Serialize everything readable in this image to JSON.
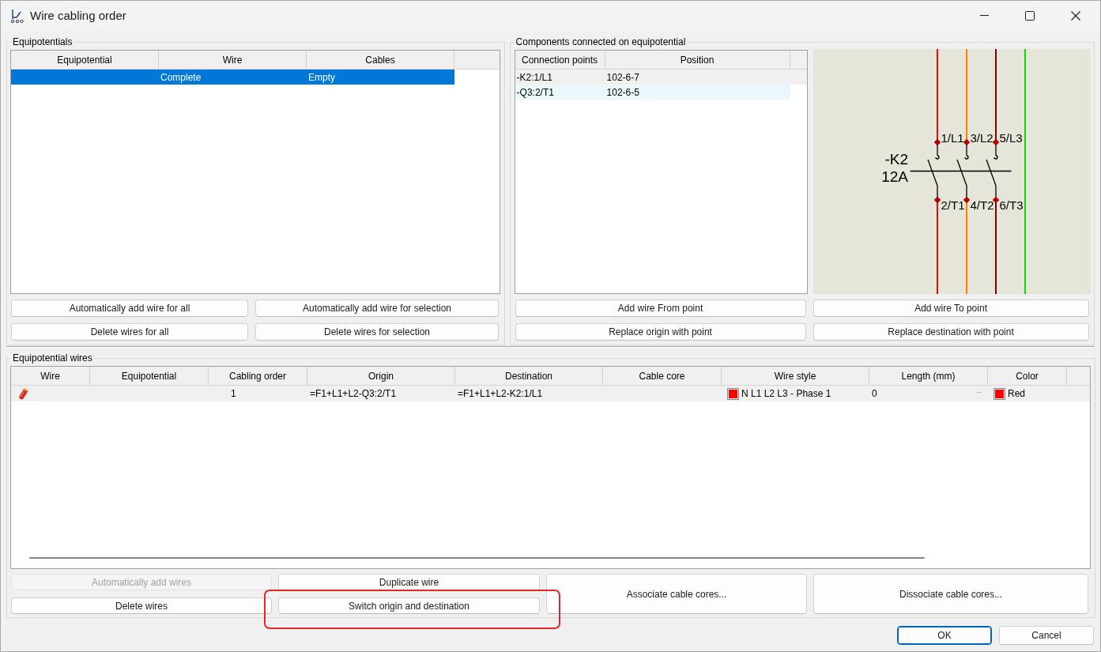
{
  "window": {
    "title": "Wire cabling order"
  },
  "equipotentials": {
    "title": "Equipotentials",
    "columns": [
      "Equipotential",
      "Wire",
      "Cables"
    ],
    "rows": [
      {
        "wire": "Complete",
        "cables": "Empty",
        "selected": true
      }
    ],
    "buttons": [
      "Automatically add wire for all",
      "Automatically add wire for selection",
      "Delete wires for all",
      "Delete wires for selection"
    ]
  },
  "components": {
    "title": "Components connected on equipotential",
    "columns": [
      "Connection points",
      "Position"
    ],
    "rows": [
      {
        "connection_point": "-K2:1/L1",
        "position": "102-6-7",
        "selected": true,
        "hovered": false
      },
      {
        "connection_point": "-Q3:2/T1",
        "position": "102-6-5",
        "selected": false,
        "hovered": true
      }
    ],
    "buttons": [
      "Add wire From point",
      "Add wire To point",
      "Replace origin with point",
      "Replace destination with point"
    ]
  },
  "schematic": {
    "device": "-K2",
    "rating": "12A",
    "top_terminals": [
      "1/L1",
      "3/L2",
      "5/L3"
    ],
    "bottom_terminals": [
      "2/T1",
      "4/T2",
      "6/T3"
    ],
    "conductors": [
      {
        "color": "#ff0000"
      },
      {
        "color": "#ff8000"
      },
      {
        "color": "#800000"
      },
      {
        "color": "#00e000"
      }
    ]
  },
  "equipotential_wires": {
    "title": "Equipotential wires",
    "columns": [
      "Wire",
      "Equipotential",
      "Cabling order",
      "Origin",
      "Destination",
      "Cable core",
      "Wire style",
      "Length (mm)",
      "Color"
    ],
    "rows": [
      {
        "cabling_order": "1",
        "origin": "=F1+L1+L2-Q3:2/T1",
        "destination": "=F1+L1+L2-K2:1/L1",
        "wire_style": {
          "color": "#ff0000",
          "label": "N L1 L2 L3 - Phase 1"
        },
        "length": "0",
        "length_button": "...",
        "wire_color": {
          "color": "#ff0000",
          "label": "Red"
        },
        "selected": true
      }
    ],
    "buttons": [
      {
        "label": "Automatically add wires",
        "kind": "small",
        "disabled": true,
        "highlighted": false
      },
      {
        "label": "Duplicate wire",
        "kind": "small",
        "disabled": false,
        "highlighted": false
      },
      {
        "label": "Associate cable cores...",
        "kind": "tall",
        "disabled": false,
        "highlighted": false
      },
      {
        "label": "Dissociate cable cores...",
        "kind": "tall",
        "disabled": false,
        "highlighted": false
      },
      {
        "label": "Delete wires",
        "kind": "small",
        "disabled": false,
        "highlighted": false
      },
      {
        "label": "Switch origin and destination",
        "kind": "small",
        "disabled": false,
        "highlighted": true
      }
    ]
  },
  "dialog_buttons": [
    {
      "label": "OK",
      "default": true
    },
    {
      "label": "Cancel",
      "default": false
    }
  ]
}
